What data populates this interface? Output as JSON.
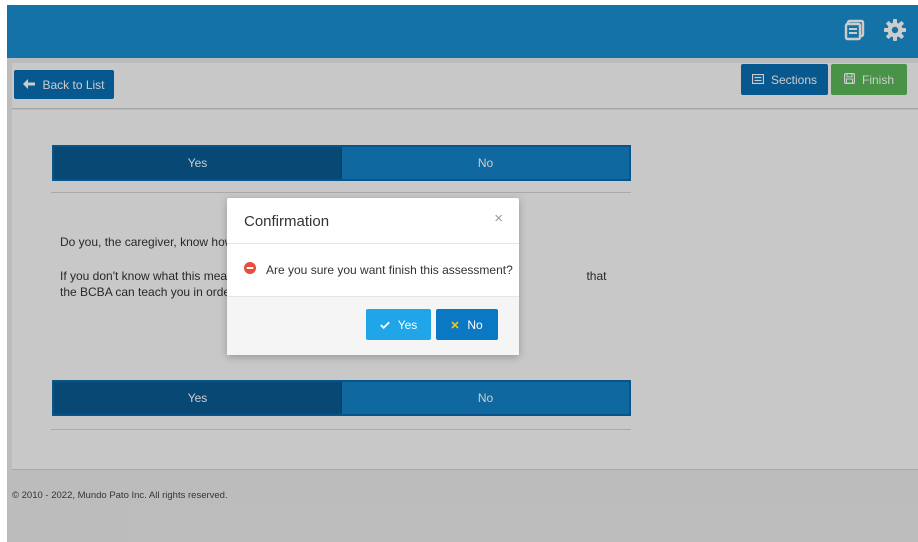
{
  "toolbar": {
    "back_label": "Back to List",
    "sections_label": "Sections",
    "finish_label": "Finish"
  },
  "content": {
    "toggle1": {
      "yes": "Yes",
      "no": "No"
    },
    "question1": "Do you, the caregiver, know how t",
    "question2": "If you don't know what this means                                                                                                        that the BCBA can teach you in order to better s",
    "toggle2": {
      "yes": "Yes",
      "no": "No"
    }
  },
  "footer": {
    "text": "© 2010 - 2022, Mundo Pato Inc. All rights reserved."
  },
  "modal": {
    "title": "Confirmation",
    "close": "×",
    "message": "Are you sure you want finish this assessment?",
    "yes_label": "Yes",
    "no_label": "No"
  },
  "colors": {
    "topbar": "#1b8fd1",
    "primary": "#0a6fb4",
    "success": "#5cb85c",
    "toggle_active": "#0b5b92",
    "toggle_inactive": "#1582c9",
    "danger": "#e74c3c"
  },
  "icons": {
    "topbar": [
      "sections-icon",
      "gear-icon"
    ],
    "back": "arrow-left-icon",
    "sections": "list-icon",
    "finish": "save-icon",
    "modal_message": "minus-circle-icon",
    "modal_yes": "check-icon",
    "modal_no": "times-icon"
  }
}
